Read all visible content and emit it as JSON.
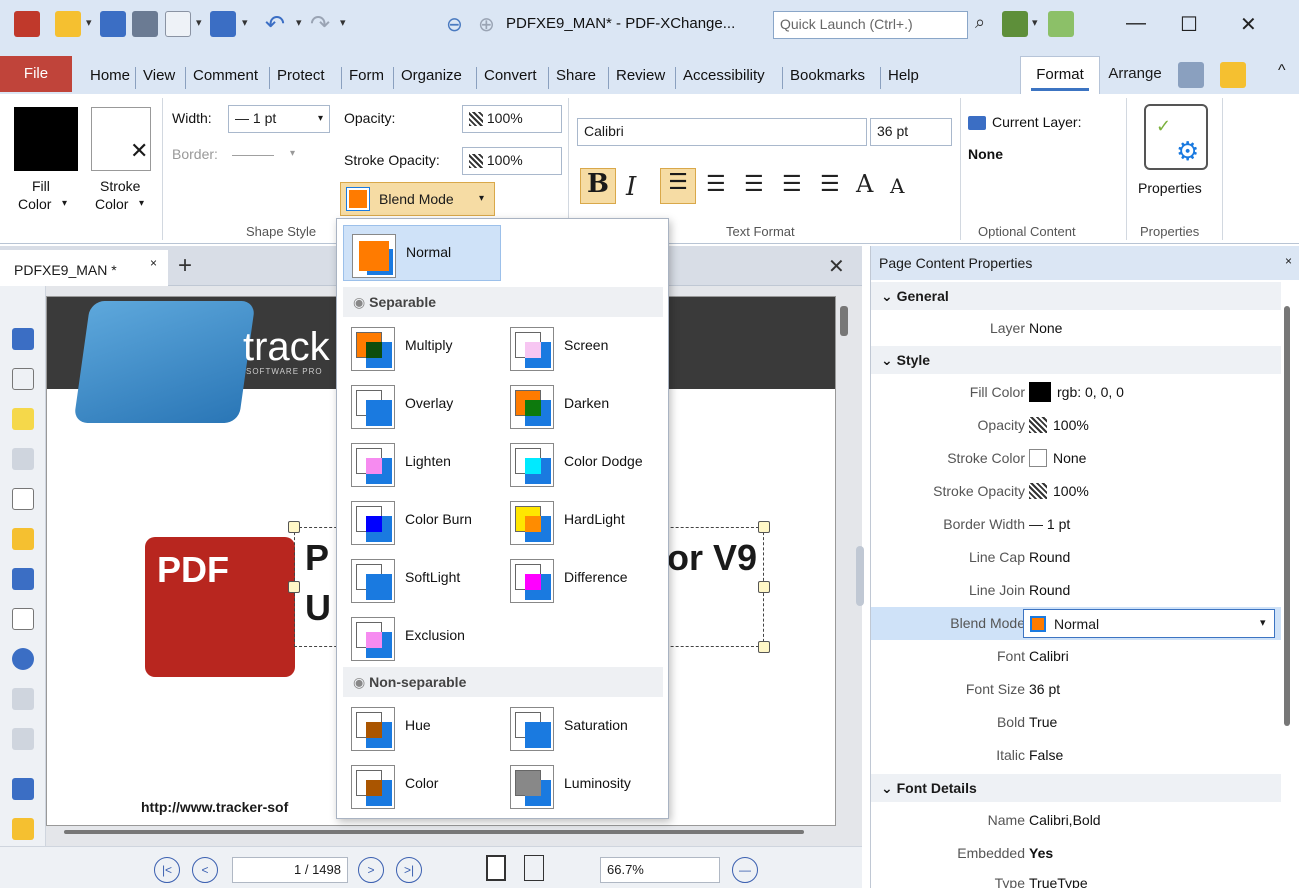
{
  "titlebar": {
    "title": "PDFXE9_MAN* - PDF-XChange...",
    "quick_launch": "Quick Launch (Ctrl+.)"
  },
  "tabs": [
    "Home",
    "View",
    "Comment",
    "Protect",
    "Form",
    "Organize",
    "Convert",
    "Share",
    "Review",
    "Accessibility",
    "Bookmarks",
    "Help"
  ],
  "file_tab": "File",
  "format_tab": "Format",
  "arrange_tab": "Arrange",
  "ribbon": {
    "fill_color": "Fill",
    "fill_color2": "Color",
    "stroke_color": "Stroke",
    "stroke_color2": "Color",
    "width_label": "Width:",
    "width_value": "— 1 pt",
    "border_label": "Border:",
    "border_value": "———",
    "opacity_label": "Opacity:",
    "opacity_value": "100%",
    "stroke_opacity_label": "Stroke Opacity:",
    "stroke_opacity_value": "100%",
    "blend_mode": "Blend Mode",
    "font": "Calibri",
    "font_size": "36 pt",
    "current_layer": "Current Layer:",
    "layer_value": "None",
    "properties": "Properties",
    "groups": {
      "shape_style": "Shape Style",
      "text_format": "Text Format",
      "optional_content": "Optional Content",
      "properties": "Properties"
    }
  },
  "doc": {
    "tab": "PDFXE9_MAN *",
    "brand": "track",
    "brand_sub": "SOFTWARE PRO",
    "pdf": "PDF",
    "h1": "P",
    "h2": "or V9",
    "h3": "U",
    "url": "http://www.tracker-sof",
    "page_input": "1 / 1498",
    "zoom": "66.7%"
  },
  "props": {
    "title": "Page Content Properties",
    "sections": {
      "general": "General",
      "style": "Style",
      "font_details": "Font Details"
    },
    "rows": [
      {
        "k": "Layer",
        "v": "None"
      },
      {
        "k": "Fill Color",
        "v": "rgb: 0, 0, 0"
      },
      {
        "k": "Opacity",
        "v": "100%"
      },
      {
        "k": "Stroke Color",
        "v": "None"
      },
      {
        "k": "Stroke Opacity",
        "v": "100%"
      },
      {
        "k": "Border Width",
        "v": "— 1 pt"
      },
      {
        "k": "Line Cap",
        "v": "Round"
      },
      {
        "k": "Line Join",
        "v": "Round"
      },
      {
        "k": "Blend Mode",
        "v": "Normal"
      },
      {
        "k": "Font",
        "v": "Calibri"
      },
      {
        "k": "Font Size",
        "v": "36 pt"
      },
      {
        "k": "Bold",
        "v": "True"
      },
      {
        "k": "Italic",
        "v": "False"
      },
      {
        "k": "Name",
        "v": "Calibri,Bold"
      },
      {
        "k": "Embedded",
        "v": "Yes"
      },
      {
        "k": "Type",
        "v": "TrueType"
      }
    ]
  },
  "blend_menu": {
    "normal": "Normal",
    "separable": "Separable",
    "non_separable": "Non-separable",
    "items": [
      "Multiply",
      "Screen",
      "Overlay",
      "Darken",
      "Lighten",
      "Color Dodge",
      "Color Burn",
      "HardLight",
      "SoftLight",
      "Difference",
      "Exclusion"
    ],
    "non_items": [
      "Hue",
      "Saturation",
      "Color",
      "Luminosity"
    ],
    "colors": {
      "normal": "#ff7b00",
      "multiply": "#0d4d0d",
      "screen": "#f7c6f2",
      "lighten": "#f68bf0",
      "dodge": "#00eaff",
      "burn": "#0000ff",
      "hard": "#ffb300",
      "diff": "#ff00ff",
      "excl": "#f68bf0",
      "hue": "#aa5500",
      "color": "#aa5500",
      "lum": "#888888"
    }
  }
}
